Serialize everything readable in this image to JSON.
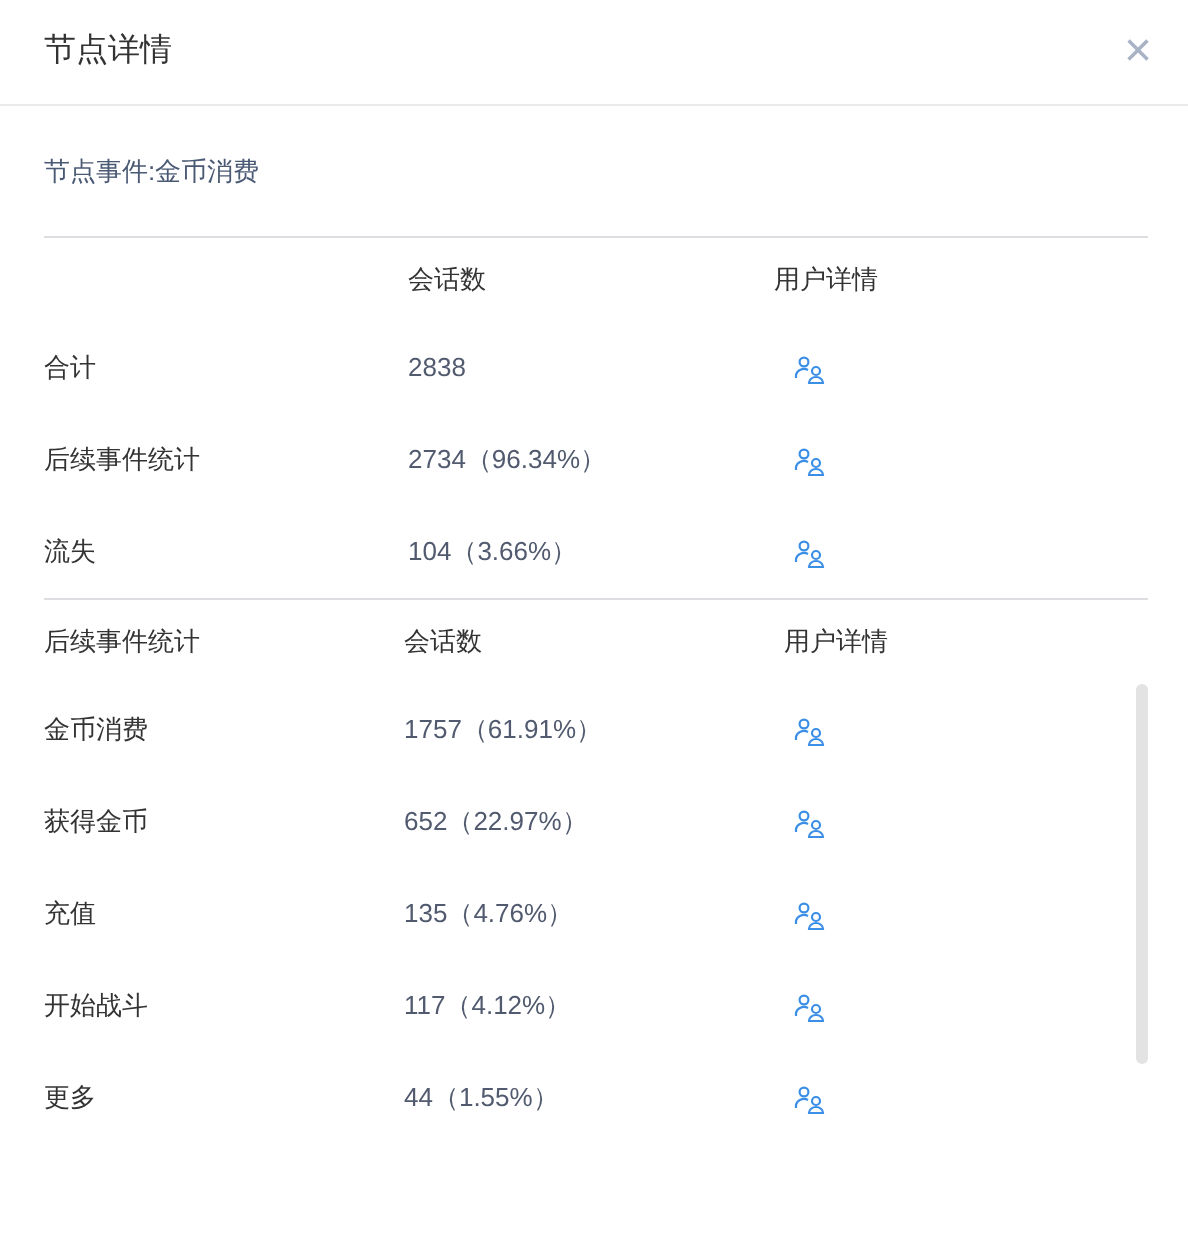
{
  "dialog": {
    "title": "节点详情",
    "close": "×"
  },
  "event_label": "节点事件:金币消费",
  "summary_table": {
    "columns": [
      "",
      "会话数",
      "用户详情"
    ],
    "rows": [
      {
        "name": "合计",
        "sessions": "2838"
      },
      {
        "name": "后续事件统计",
        "sessions": "2734（96.34%）"
      },
      {
        "name": "流失",
        "sessions": "104（3.66%）"
      }
    ]
  },
  "followup_table": {
    "columns": [
      "后续事件统计",
      "会话数",
      "用户详情"
    ],
    "rows": [
      {
        "name": "金币消费",
        "sessions": "1757（61.91%）"
      },
      {
        "name": "获得金币",
        "sessions": "652（22.97%）"
      },
      {
        "name": "充值",
        "sessions": "135（4.76%）"
      },
      {
        "name": "开始战斗",
        "sessions": "117（4.12%）"
      },
      {
        "name": "更多",
        "sessions": "44（1.55%）"
      }
    ]
  }
}
